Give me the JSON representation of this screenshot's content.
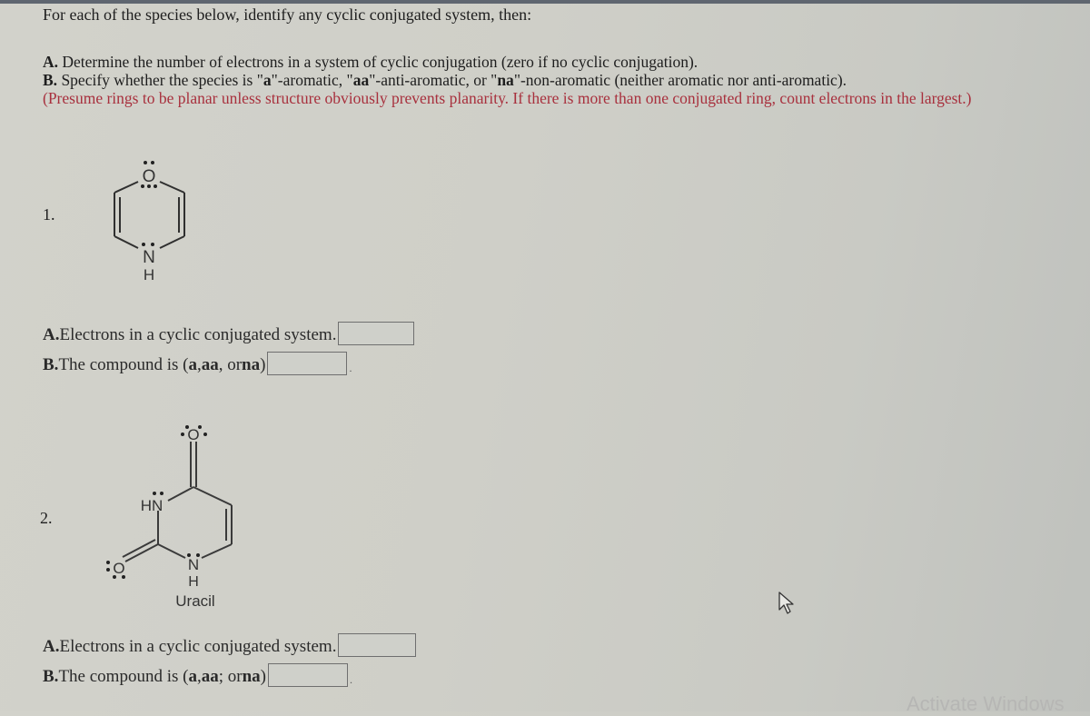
{
  "question": {
    "intro": "For each of the species below, identify any cyclic conjugated system, then:",
    "instruction_a_prefix": "A.",
    "instruction_a_text": " Determine the number of electrons in a system of cyclic conjugation (zero if no cyclic conjugation).",
    "instruction_b_prefix": "B.",
    "instruction_b_text_1": " Specify whether the species is \"",
    "instruction_b_code_a": "a",
    "instruction_b_text_2": "\"-aromatic, \"",
    "instruction_b_code_aa": "aa",
    "instruction_b_text_3": "\"-anti-aromatic, or \"",
    "instruction_b_code_na": "na",
    "instruction_b_text_4": "\"-non-aromatic (neither aromatic nor anti-aromatic).",
    "note": "(Presume rings to be planar unless structure obviously prevents planarity. If there is more than one conjugated ring, count electrons in the largest.)",
    "note_color": "#a8303d"
  },
  "items": [
    {
      "number": "1.",
      "molecule": {
        "atom_top": "O",
        "atom_bottom": "N",
        "atom_bottom_h": "H",
        "name": ""
      },
      "answer_a": {
        "prefix": "A.",
        "label": "Electrons in a cyclic conjugated system.",
        "value": ""
      },
      "answer_b": {
        "prefix": "B.",
        "label_1": "The compound is (",
        "opt_a": "a",
        "sep_1": ", ",
        "opt_aa": "aa",
        "sep_2": ", or ",
        "opt_na": "na",
        "label_2": ")",
        "value": ""
      }
    },
    {
      "number": "2.",
      "molecule": {
        "atom_o_top": "O",
        "atom_hn": "HN",
        "atom_o_left": "O",
        "atom_n_bottom": "N",
        "atom_h_bottom": "H",
        "name": "Uracil"
      },
      "answer_a": {
        "prefix": "A.",
        "label": "Electrons in a cyclic conjugated system.",
        "value": ""
      },
      "answer_b": {
        "prefix": "B.",
        "label_1": "The compound is (",
        "opt_a": "a",
        "sep_1": ", ",
        "opt_aa": "aa",
        "sep_2": "; or ",
        "opt_na": "na",
        "label_2": ")",
        "value": ""
      }
    }
  ],
  "icons": {
    "cursor": "mouse-pointer-icon"
  },
  "watermark": "Activate Windows"
}
